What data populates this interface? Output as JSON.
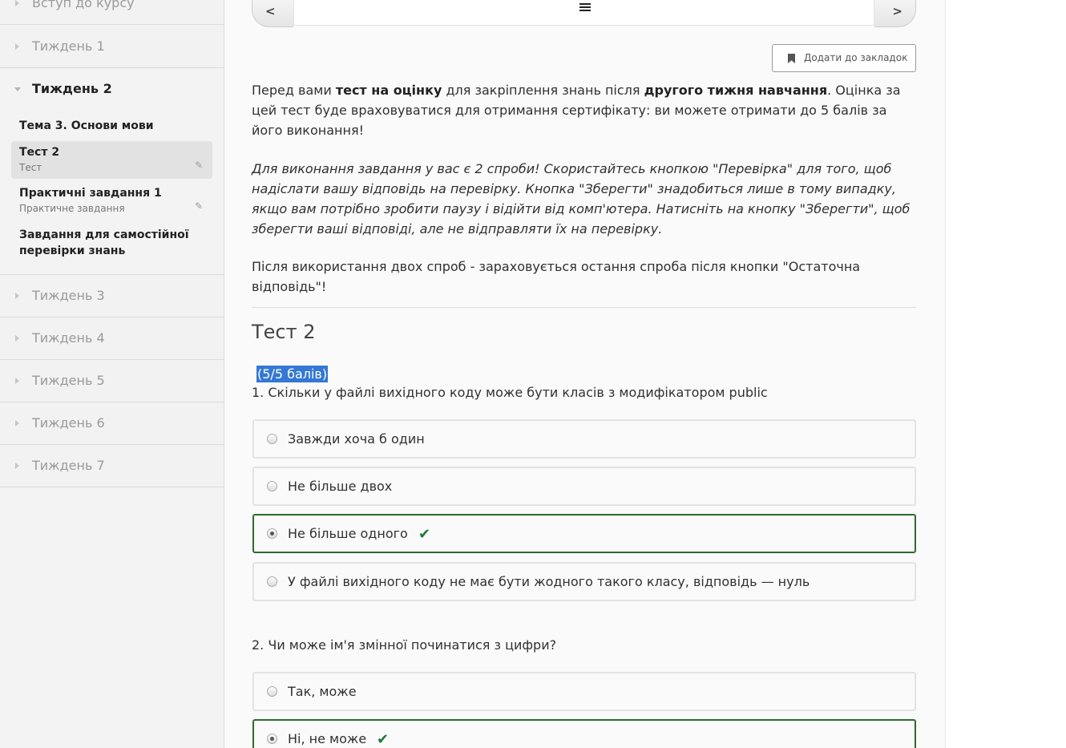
{
  "sidebar": {
    "intro": "Вступ до курсу",
    "weeks_before": [
      "Тиждень 1"
    ],
    "open_week": {
      "label": "Тиждень 2",
      "items": [
        {
          "title": "Тема 3. Основи мови",
          "subtitle": ""
        },
        {
          "title": "Тест 2",
          "subtitle": "Тест",
          "active": true
        },
        {
          "title": "Практичні завдання 1",
          "subtitle": "Практичне завдання"
        },
        {
          "title": "Завдання для самостійної перевірки знань",
          "subtitle": ""
        }
      ]
    },
    "weeks_after": [
      "Тиждень 3",
      "Тиждень 4",
      "Тиждень 5",
      "Тиждень 6",
      "Тиждень 7"
    ]
  },
  "nav": {
    "prev_icon": "chevron-left",
    "next_icon": "chevron-right",
    "list_icon": "list-icon"
  },
  "bookmark": {
    "label": "Додати до закладок",
    "icon": "bookmark-icon"
  },
  "intro": {
    "p1_a": "Перед вами ",
    "p1_b": "тест на оцінку",
    "p1_c": " для закріплення знань після ",
    "p1_d": "другого тижня навчання",
    "p1_e": ". Оцінка за цей тест буде враховуватися для отримання сертифікату: ви можете отримати до 5 балів за його виконання!",
    "p2": "Для виконання завдання у вас є 2 спроби! Скористайтесь кнопкою \"Перевірка\" для того, щоб надіслати вашу відповідь на перевірку. Кнопка \"Зберегти\" знадобиться лише в тому випадку, якщо вам потрібно зробити паузу і відійти від комп'ютера. Натисніть на кнопку \"Зберегти\", щоб зберегти ваші відповіді, але не відправляти їх на перевірку.",
    "p3": "Після використання двох спроб - зараховується остання спроба після кнопки \"Остаточна відповідь\"!"
  },
  "test": {
    "title": "Тест 2",
    "score": "(5/5 балів)",
    "q1": {
      "text": "1. Скільки у файлі вихідного коду може бути класів з модифікатором public",
      "options": [
        {
          "label": "Завжди хоча б один",
          "selected": false
        },
        {
          "label": "Не більше двох",
          "selected": false
        },
        {
          "label": "Не більше одного",
          "selected": true,
          "correct": true
        },
        {
          "label": "У файлі вихідного коду не має бути жодного такого класу, відповідь — нуль",
          "selected": false
        }
      ]
    },
    "q2": {
      "text": "2. Чи може ім'я змінної починатися з цифри?",
      "options": [
        {
          "label": "Так, може",
          "selected": false
        },
        {
          "label": "Ні, не може",
          "selected": true,
          "correct": true
        }
      ]
    }
  },
  "colors": {
    "correct_border": "#2e6b2e",
    "check": "#1f7a3a",
    "highlight": "#3478d4"
  }
}
